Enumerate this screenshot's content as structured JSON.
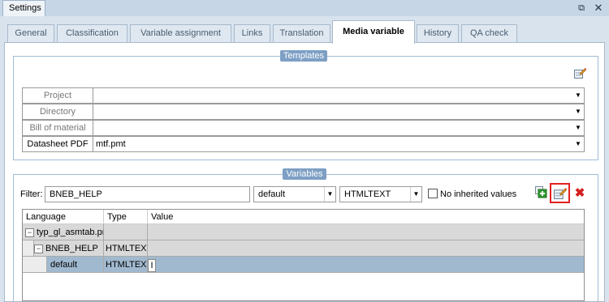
{
  "window": {
    "title": "Settings",
    "restore_icon": "restore-icon",
    "close_icon": "close-icon"
  },
  "tabs": [
    {
      "label": "General"
    },
    {
      "label": "Classification"
    },
    {
      "label": "Variable assignment"
    },
    {
      "label": "Links"
    },
    {
      "label": "Translation"
    },
    {
      "label": "Media variable",
      "active": true
    },
    {
      "label": "History"
    },
    {
      "label": "QA check"
    }
  ],
  "templates": {
    "legend": "Templates",
    "edit_icon": "edit-icon",
    "rows": [
      {
        "label": "Project",
        "value": ""
      },
      {
        "label": "Directory",
        "value": ""
      },
      {
        "label": "Bill of material",
        "value": ""
      },
      {
        "label": "Datasheet PDF",
        "value": "mtf.pmt"
      }
    ]
  },
  "variables": {
    "legend": "Variables",
    "filter_label": "Filter:",
    "filter_value": "BNEB_HELP",
    "lang_combo": "default",
    "type_combo": "HTMLTEXT",
    "no_inherited_label": "No inherited values",
    "no_inherited_checked": false,
    "add_icon": "add-icon",
    "edit_icon": "edit-icon",
    "delete_icon": "delete-icon",
    "columns": [
      "Language",
      "Type",
      "Value"
    ],
    "rows": [
      {
        "language": "typ_gl_asmtab.pmf",
        "type": "",
        "value": "",
        "expander": "⊟"
      },
      {
        "language": "BNEB_HELP",
        "type": "HTMLTEXT",
        "value": "",
        "expander": "⊟"
      },
      {
        "language": "default",
        "type": "HTMLTEXT",
        "value": "I",
        "expander": ""
      }
    ]
  },
  "colors": {
    "accent": "#7d9fc4",
    "highlight": "#e02020",
    "selection": "#a1b9cf"
  }
}
